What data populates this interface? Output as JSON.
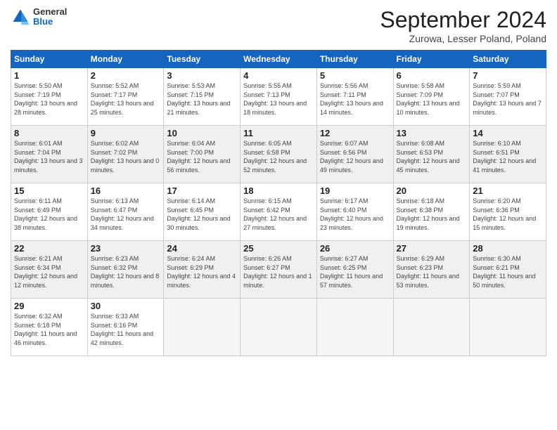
{
  "logo": {
    "general": "General",
    "blue": "Blue"
  },
  "title": "September 2024",
  "location": "Zurowa, Lesser Poland, Poland",
  "weekdays": [
    "Sunday",
    "Monday",
    "Tuesday",
    "Wednesday",
    "Thursday",
    "Friday",
    "Saturday"
  ],
  "weeks": [
    [
      {
        "day": "1",
        "sunrise": "Sunrise: 5:50 AM",
        "sunset": "Sunset: 7:19 PM",
        "daylight": "Daylight: 13 hours and 28 minutes."
      },
      {
        "day": "2",
        "sunrise": "Sunrise: 5:52 AM",
        "sunset": "Sunset: 7:17 PM",
        "daylight": "Daylight: 13 hours and 25 minutes."
      },
      {
        "day": "3",
        "sunrise": "Sunrise: 5:53 AM",
        "sunset": "Sunset: 7:15 PM",
        "daylight": "Daylight: 13 hours and 21 minutes."
      },
      {
        "day": "4",
        "sunrise": "Sunrise: 5:55 AM",
        "sunset": "Sunset: 7:13 PM",
        "daylight": "Daylight: 13 hours and 18 minutes."
      },
      {
        "day": "5",
        "sunrise": "Sunrise: 5:56 AM",
        "sunset": "Sunset: 7:11 PM",
        "daylight": "Daylight: 13 hours and 14 minutes."
      },
      {
        "day": "6",
        "sunrise": "Sunrise: 5:58 AM",
        "sunset": "Sunset: 7:09 PM",
        "daylight": "Daylight: 13 hours and 10 minutes."
      },
      {
        "day": "7",
        "sunrise": "Sunrise: 5:59 AM",
        "sunset": "Sunset: 7:07 PM",
        "daylight": "Daylight: 13 hours and 7 minutes."
      }
    ],
    [
      {
        "day": "8",
        "sunrise": "Sunrise: 6:01 AM",
        "sunset": "Sunset: 7:04 PM",
        "daylight": "Daylight: 13 hours and 3 minutes."
      },
      {
        "day": "9",
        "sunrise": "Sunrise: 6:02 AM",
        "sunset": "Sunset: 7:02 PM",
        "daylight": "Daylight: 13 hours and 0 minutes."
      },
      {
        "day": "10",
        "sunrise": "Sunrise: 6:04 AM",
        "sunset": "Sunset: 7:00 PM",
        "daylight": "Daylight: 12 hours and 56 minutes."
      },
      {
        "day": "11",
        "sunrise": "Sunrise: 6:05 AM",
        "sunset": "Sunset: 6:58 PM",
        "daylight": "Daylight: 12 hours and 52 minutes."
      },
      {
        "day": "12",
        "sunrise": "Sunrise: 6:07 AM",
        "sunset": "Sunset: 6:56 PM",
        "daylight": "Daylight: 12 hours and 49 minutes."
      },
      {
        "day": "13",
        "sunrise": "Sunrise: 6:08 AM",
        "sunset": "Sunset: 6:53 PM",
        "daylight": "Daylight: 12 hours and 45 minutes."
      },
      {
        "day": "14",
        "sunrise": "Sunrise: 6:10 AM",
        "sunset": "Sunset: 6:51 PM",
        "daylight": "Daylight: 12 hours and 41 minutes."
      }
    ],
    [
      {
        "day": "15",
        "sunrise": "Sunrise: 6:11 AM",
        "sunset": "Sunset: 6:49 PM",
        "daylight": "Daylight: 12 hours and 38 minutes."
      },
      {
        "day": "16",
        "sunrise": "Sunrise: 6:13 AM",
        "sunset": "Sunset: 6:47 PM",
        "daylight": "Daylight: 12 hours and 34 minutes."
      },
      {
        "day": "17",
        "sunrise": "Sunrise: 6:14 AM",
        "sunset": "Sunset: 6:45 PM",
        "daylight": "Daylight: 12 hours and 30 minutes."
      },
      {
        "day": "18",
        "sunrise": "Sunrise: 6:15 AM",
        "sunset": "Sunset: 6:42 PM",
        "daylight": "Daylight: 12 hours and 27 minutes."
      },
      {
        "day": "19",
        "sunrise": "Sunrise: 6:17 AM",
        "sunset": "Sunset: 6:40 PM",
        "daylight": "Daylight: 12 hours and 23 minutes."
      },
      {
        "day": "20",
        "sunrise": "Sunrise: 6:18 AM",
        "sunset": "Sunset: 6:38 PM",
        "daylight": "Daylight: 12 hours and 19 minutes."
      },
      {
        "day": "21",
        "sunrise": "Sunrise: 6:20 AM",
        "sunset": "Sunset: 6:36 PM",
        "daylight": "Daylight: 12 hours and 15 minutes."
      }
    ],
    [
      {
        "day": "22",
        "sunrise": "Sunrise: 6:21 AM",
        "sunset": "Sunset: 6:34 PM",
        "daylight": "Daylight: 12 hours and 12 minutes."
      },
      {
        "day": "23",
        "sunrise": "Sunrise: 6:23 AM",
        "sunset": "Sunset: 6:32 PM",
        "daylight": "Daylight: 12 hours and 8 minutes."
      },
      {
        "day": "24",
        "sunrise": "Sunrise: 6:24 AM",
        "sunset": "Sunset: 6:29 PM",
        "daylight": "Daylight: 12 hours and 4 minutes."
      },
      {
        "day": "25",
        "sunrise": "Sunrise: 6:26 AM",
        "sunset": "Sunset: 6:27 PM",
        "daylight": "Daylight: 12 hours and 1 minute."
      },
      {
        "day": "26",
        "sunrise": "Sunrise: 6:27 AM",
        "sunset": "Sunset: 6:25 PM",
        "daylight": "Daylight: 11 hours and 57 minutes."
      },
      {
        "day": "27",
        "sunrise": "Sunrise: 6:29 AM",
        "sunset": "Sunset: 6:23 PM",
        "daylight": "Daylight: 11 hours and 53 minutes."
      },
      {
        "day": "28",
        "sunrise": "Sunrise: 6:30 AM",
        "sunset": "Sunset: 6:21 PM",
        "daylight": "Daylight: 11 hours and 50 minutes."
      }
    ],
    [
      {
        "day": "29",
        "sunrise": "Sunrise: 6:32 AM",
        "sunset": "Sunset: 6:18 PM",
        "daylight": "Daylight: 11 hours and 46 minutes."
      },
      {
        "day": "30",
        "sunrise": "Sunrise: 6:33 AM",
        "sunset": "Sunset: 6:16 PM",
        "daylight": "Daylight: 11 hours and 42 minutes."
      },
      null,
      null,
      null,
      null,
      null
    ]
  ]
}
